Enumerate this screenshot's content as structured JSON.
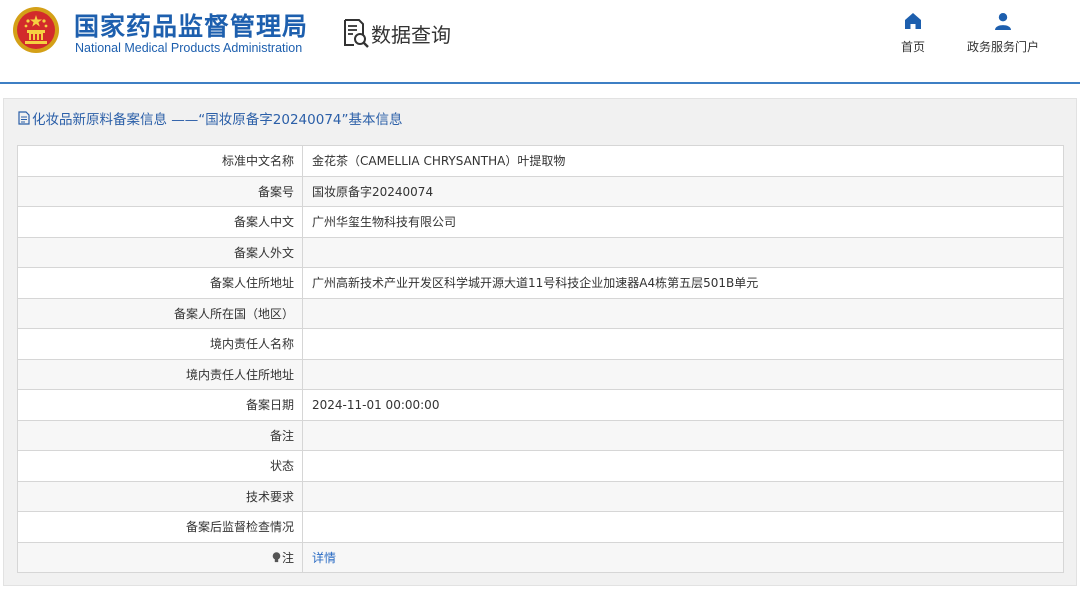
{
  "header": {
    "logo_cn": "国家药品监督管理局",
    "logo_en": "National Medical Products Administration",
    "page_title": "数据查询",
    "nav": [
      {
        "label": "首页",
        "icon": "home-icon"
      },
      {
        "label": "政务服务门户",
        "icon": "user-icon"
      }
    ]
  },
  "panel": {
    "title": "化妆品新原料备案信息 ——“国妆原备字20240074”基本信息",
    "rows": [
      {
        "label": "标准中文名称",
        "value": "金花茶（CAMELLIA CHRYSANTHA）叶提取物"
      },
      {
        "label": "备案号",
        "value": "国妆原备字20240074"
      },
      {
        "label": "备案人中文",
        "value": "广州华玺生物科技有限公司"
      },
      {
        "label": "备案人外文",
        "value": ""
      },
      {
        "label": "备案人住所地址",
        "value": "广州高新技术产业开发区科学城开源大道11号科技企业加速器A4栋第五层501B单元"
      },
      {
        "label": "备案人所在国（地区）",
        "value": ""
      },
      {
        "label": "境内责任人名称",
        "value": ""
      },
      {
        "label": "境内责任人住所地址",
        "value": ""
      },
      {
        "label": "备案日期",
        "value": "2024-11-01 00:00:00"
      },
      {
        "label": "备注",
        "value": ""
      },
      {
        "label": "状态",
        "value": ""
      },
      {
        "label": "技术要求",
        "value": ""
      },
      {
        "label": "备案后监督检查情况",
        "value": ""
      }
    ],
    "note": {
      "label": "注",
      "link": "详情"
    }
  },
  "colors": {
    "brand_blue": "#1d5fae",
    "link_blue": "#2b6cc4",
    "border": "#d6d6d6"
  }
}
